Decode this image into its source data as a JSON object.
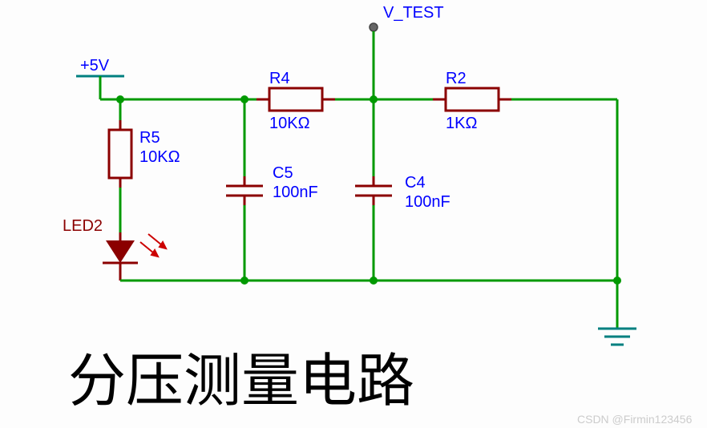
{
  "power": {
    "label": "+5V"
  },
  "test_point": {
    "label": "V_TEST"
  },
  "components": {
    "R5": {
      "ref": "R5",
      "value": "10KΩ"
    },
    "R4": {
      "ref": "R4",
      "value": "10KΩ"
    },
    "R2": {
      "ref": "R2",
      "value": "1KΩ"
    },
    "C5": {
      "ref": "C5",
      "value": "100nF"
    },
    "C4": {
      "ref": "C4",
      "value": "100nF"
    },
    "LED2": {
      "ref": "LED2"
    }
  },
  "title": "分压测量电路",
  "watermark": "CSDN @Firmin123456"
}
